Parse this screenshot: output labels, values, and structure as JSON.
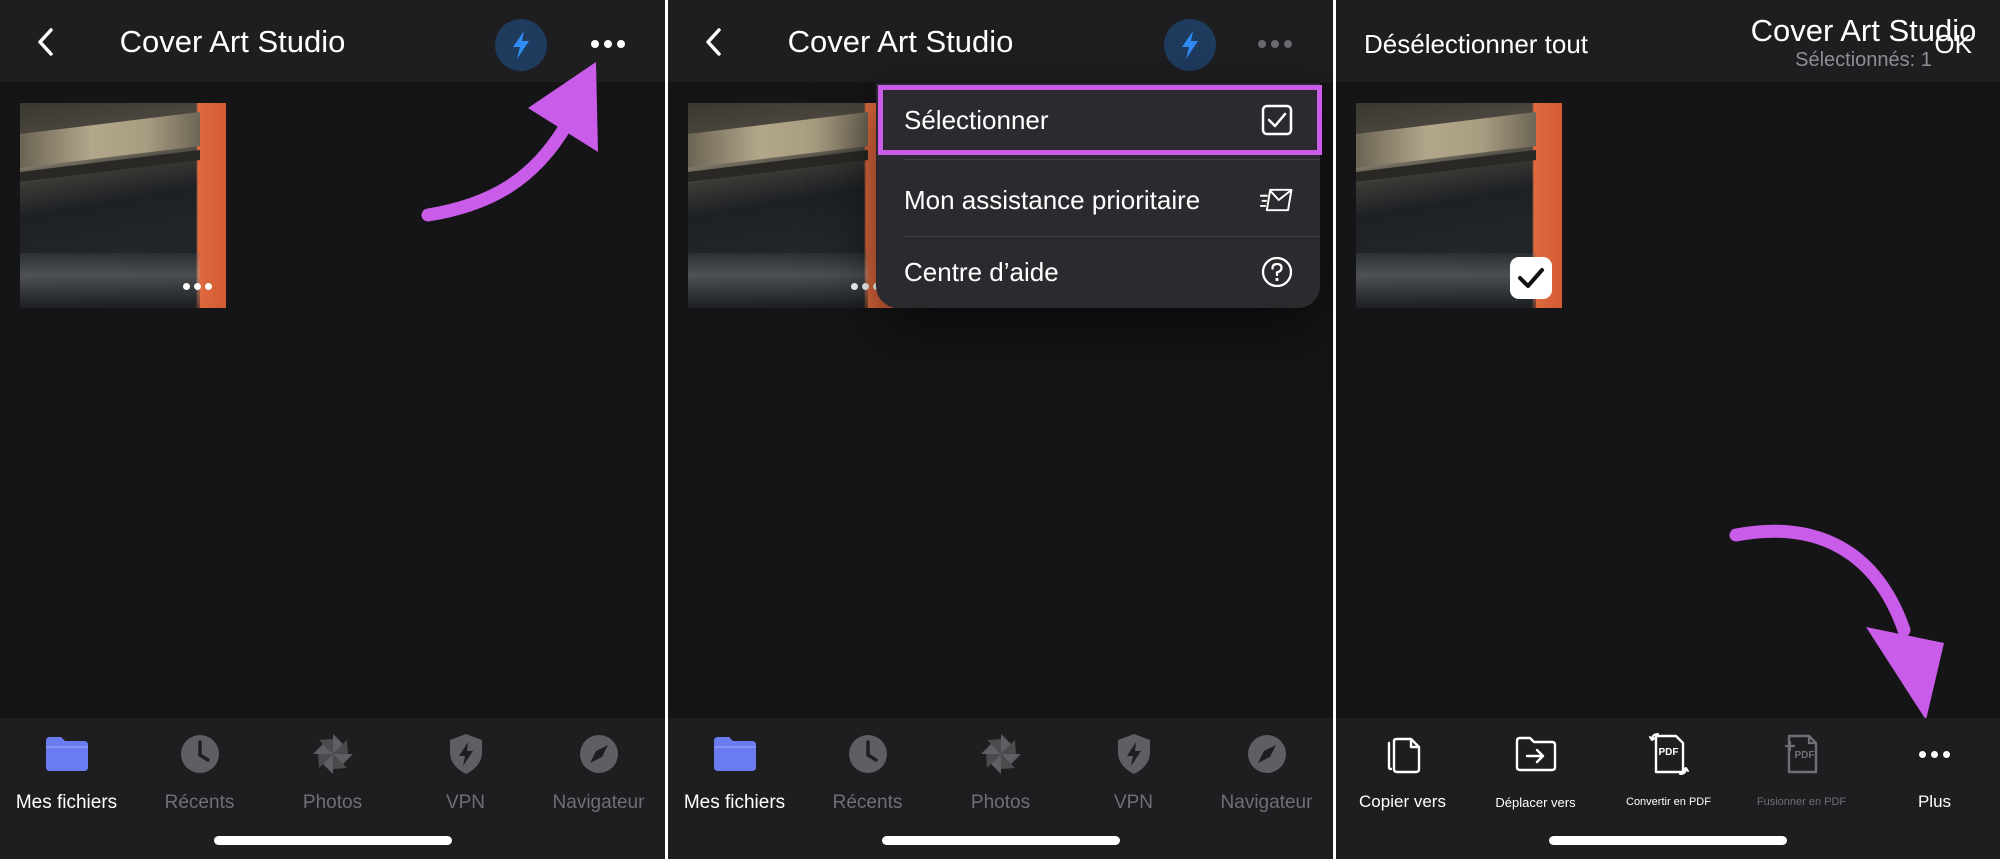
{
  "colors": {
    "background": "#151517",
    "bar": "#1e1e21",
    "accent": "#c95ce8",
    "folder": "#6b7cf0",
    "bolt": "#2f8cf2"
  },
  "app": {
    "title": "Cover Art Studio"
  },
  "tabs": [
    {
      "label": "Mes fichiers",
      "icon": "folder-icon"
    },
    {
      "label": "Récents",
      "icon": "clock-icon"
    },
    {
      "label": "Photos",
      "icon": "pinwheel-icon"
    },
    {
      "label": "VPN",
      "icon": "shield-bolt-icon"
    },
    {
      "label": "Navigateur",
      "icon": "compass-icon"
    }
  ],
  "menu": {
    "items": [
      {
        "label": "Sélectionner",
        "icon": "checkbox-icon"
      },
      {
        "label": "Mon assistance prioritaire",
        "icon": "mail-fast-icon"
      },
      {
        "label": "Centre d’aide",
        "icon": "help-icon"
      }
    ]
  },
  "selection": {
    "deselect_all": "Désélectionner tout",
    "count_label": "Sélectionnés: 1",
    "ok": "OK"
  },
  "actions": [
    {
      "label": "Copier vers",
      "icon": "copy-icon"
    },
    {
      "label": "Déplacer vers",
      "icon": "move-folder-icon"
    },
    {
      "label": "Convertir en PDF",
      "icon": "convert-pdf-icon",
      "icon_text": "PDF"
    },
    {
      "label": "Fusionner en PDF",
      "icon": "merge-pdf-icon",
      "icon_text": "PDF",
      "disabled": true
    },
    {
      "label": "Plus",
      "icon": "more-icon"
    }
  ]
}
